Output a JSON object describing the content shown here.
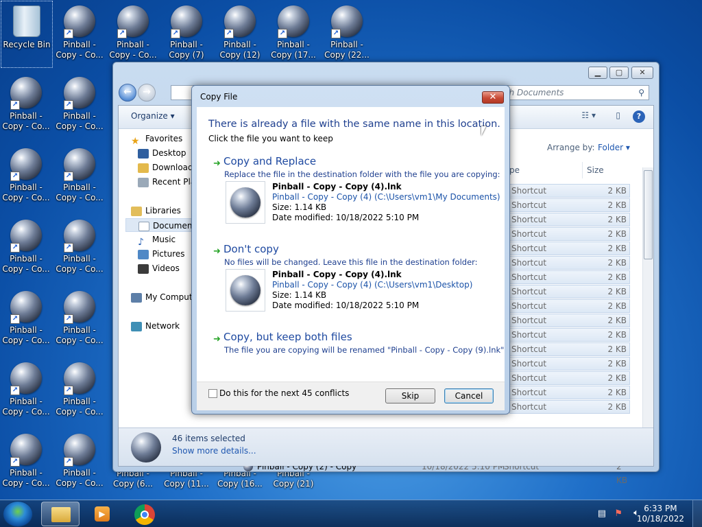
{
  "desktop": {
    "icons": [
      {
        "label": "Recycle Bin",
        "type": "bin"
      },
      {
        "label": "Pinball -\nCopy - Co...",
        "type": "ball"
      },
      {
        "label": "Pinball -\nCopy - Co...",
        "type": "ball"
      },
      {
        "label": "Pinball -\nCopy (7)",
        "type": "ball"
      },
      {
        "label": "Pinball -\nCopy (12)",
        "type": "ball"
      },
      {
        "label": "Pinball -\nCopy (17...",
        "type": "ball"
      },
      {
        "label": "Pinball -\nCopy (22...",
        "type": "ball"
      }
    ],
    "left_col_label": "Pinball -\nCopy - Co...",
    "bottom_labels": [
      "Pinball -\nCopy (6...",
      "Pinball -\nCopy (11...",
      "Pinball -\nCopy (16...",
      "Pinball -\nCopy (21)"
    ]
  },
  "explorer": {
    "search_placeholder": "ch Documents",
    "organize_label": "Organize ▾",
    "arrange_label": "Arrange by:",
    "arrange_value": "Folder ▾",
    "col_type": "pe",
    "col_size": "Size",
    "nav_items": [
      {
        "label": "Favorites",
        "icon": "star-icon"
      },
      {
        "label": "Desktop",
        "icon": "desktop-icon"
      },
      {
        "label": "Downloads",
        "icon": "downloads-icon"
      },
      {
        "label": "Recent Places",
        "icon": "recent-places-icon"
      },
      {
        "label": "Libraries",
        "icon": "libraries-icon"
      },
      {
        "label": "Documents",
        "icon": "documents-icon"
      },
      {
        "label": "Music",
        "icon": "music-icon"
      },
      {
        "label": "Pictures",
        "icon": "pictures-icon"
      },
      {
        "label": "Videos",
        "icon": "videos-icon"
      },
      {
        "label": "My Computer",
        "icon": "computer-icon"
      },
      {
        "label": "Network",
        "icon": "network-icon"
      }
    ],
    "row_type": "Shortcut",
    "row_size": "2 KB",
    "last_row": {
      "name": "Pinball - Copy (2) - Copy",
      "date": "10/18/2022 5:10 PM",
      "type": "Shortcut",
      "size": "2 KB"
    },
    "status_count": "46 items selected",
    "status_more": "Show more details..."
  },
  "dialog": {
    "title": "Copy File",
    "heading": "There is already a file with the same name in this location.",
    "instruction": "Click the file you want to keep",
    "opt1": {
      "title": "Copy and Replace",
      "sub": "Replace the file in the destination folder with the file you are copying:",
      "fname": "Pinball - Copy - Copy (4).lnk",
      "fpath": "Pinball - Copy - Copy (4) (C:\\Users\\vm1\\My Documents)",
      "size": "Size: 1.14 KB",
      "date": "Date modified: 10/18/2022 5:10 PM"
    },
    "opt2": {
      "title": "Don't copy",
      "sub": "No files will be changed. Leave this file in the destination folder:",
      "fname": "Pinball - Copy - Copy (4).lnk",
      "fpath": "Pinball - Copy - Copy (4) (C:\\Users\\vm1\\Desktop)",
      "size": "Size: 1.14 KB",
      "date": "Date modified: 10/18/2022 5:10 PM"
    },
    "opt3": {
      "title": "Copy, but keep both files",
      "sub": "The file you are copying will be renamed \"Pinball - Copy - Copy (9).lnk\""
    },
    "checkbox_label": "Do this for the next 45 conflicts",
    "skip_label": "Skip",
    "cancel_label": "Cancel"
  },
  "taskbar": {
    "time": "6:33 PM",
    "date": "10/18/2022"
  }
}
